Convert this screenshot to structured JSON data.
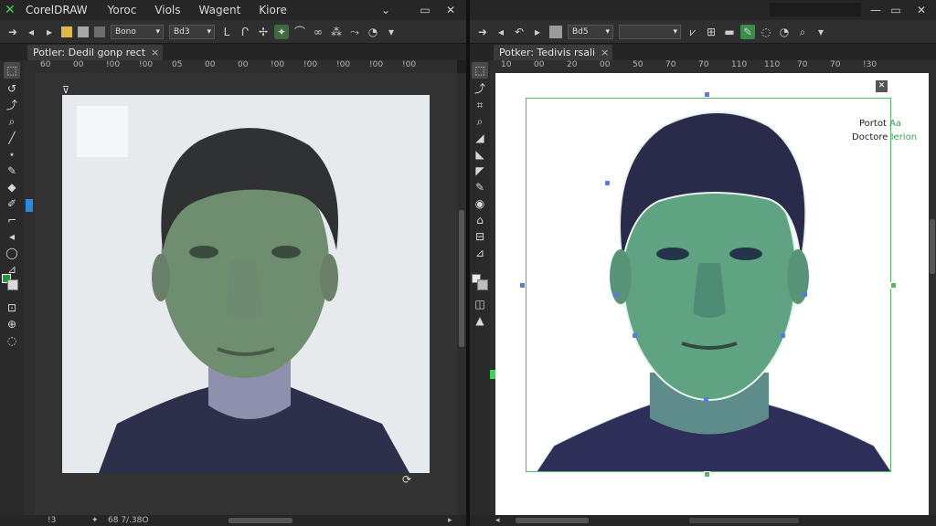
{
  "left": {
    "app_name": "CorelDRAW",
    "menu": [
      "Yoroc",
      "Viols",
      "Wagent",
      "Kiore"
    ],
    "window_buttons": [
      "⌄",
      "▭",
      "✕"
    ],
    "toolbar_dropdowns": [
      "Bono",
      "Bd3"
    ],
    "tab_label": "Potler: Dedil gonp rect",
    "tab_close": "×",
    "ruler_labels": [
      "60",
      "00",
      "!00",
      "!00",
      "05",
      "00",
      "00",
      "!00",
      "!00",
      "!00",
      "!00",
      "!00"
    ],
    "status_left": "!3",
    "status_mid": "68 7/.38O"
  },
  "right": {
    "window_buttons": [
      "—",
      "▭",
      "✕"
    ],
    "toolbar_dropdowns": [
      "Bd5",
      ""
    ],
    "tab_label": "Potker: Tedivis rsali",
    "tab_close": "×",
    "ruler_labels": [
      "10",
      "00",
      "20",
      "00",
      "50",
      "70",
      "70",
      "110",
      "110",
      "70",
      "70",
      "!30"
    ],
    "overlay_label_top_a": "Portot",
    "overlay_label_top_b": "Aa",
    "overlay_label_bottom_a": "Doctore",
    "overlay_label_bottom_b": "Ierion",
    "close_badge": "✕"
  },
  "colors": {
    "accent": "#3bd35a",
    "selection_blue": "#5a7bd8",
    "selection_green": "#58b66a"
  }
}
